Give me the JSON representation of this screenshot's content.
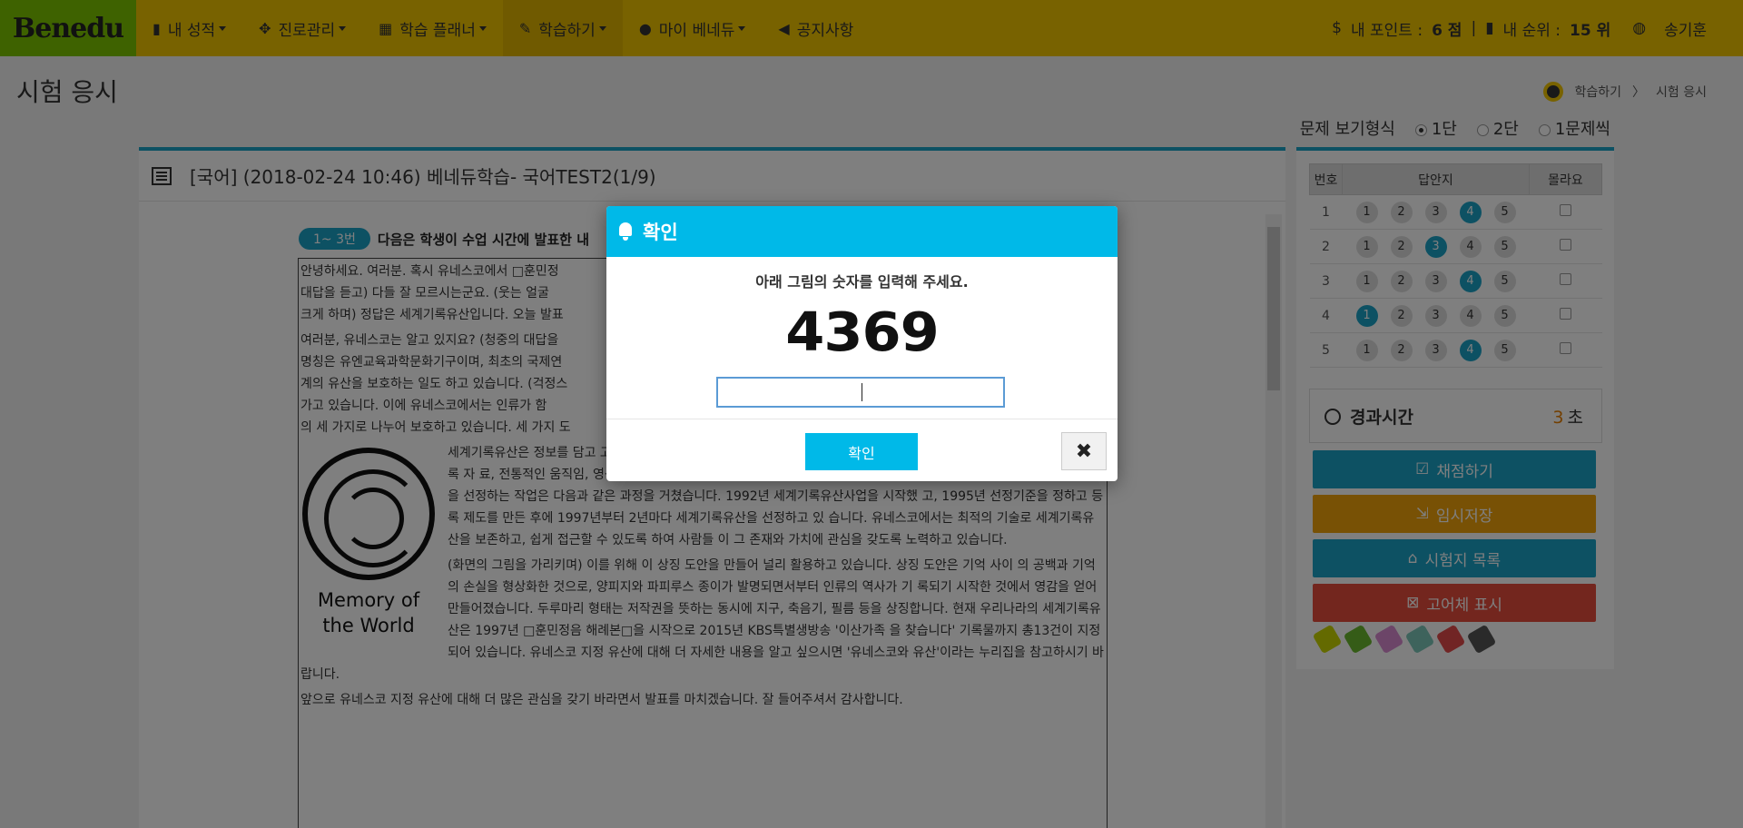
{
  "nav": {
    "logo": "Benedu",
    "items": [
      {
        "icon": "bar-chart-icon",
        "glyph": "▮",
        "label": "내 성적"
      },
      {
        "icon": "compass-icon",
        "glyph": "✥",
        "label": "진로관리"
      },
      {
        "icon": "calendar-icon",
        "glyph": "▦",
        "label": "학습 플래너"
      },
      {
        "icon": "edit-icon",
        "glyph": "✎",
        "label": "학습하기"
      },
      {
        "icon": "user-icon",
        "glyph": "●",
        "label": "마이 베네듀"
      }
    ],
    "notice": {
      "icon": "bullhorn-icon",
      "glyph": "◀",
      "label": "공지사항"
    },
    "points_label": "내 포인트 :",
    "points_value": "6 점",
    "divider": "|",
    "rank_label": "내 순위 :",
    "rank_value": "15 위",
    "user_name": "송기훈"
  },
  "page": {
    "title": "시험 응시",
    "breadcrumb": [
      "학습하기",
      "시험 응시"
    ],
    "view_type_label": "문제 보기형식",
    "view_options": [
      "1단",
      "2단",
      "1문제씩"
    ],
    "selected_view": "1단"
  },
  "exam": {
    "title": "[국어] (2018-02-24 10:46) 베네듀학습- 국어TEST2(1/9)",
    "question_range": "1~ 3번",
    "question_intro": "다음은 학생이 수업 시간에 발표한 내",
    "paragraphs": [
      "안녕하세요. 여러분. 혹시 유네스코에서 □훈민정",
      "대답을 듣고) 다들 잘 모르시는군요. (웃는 얼굴",
      "크게 하며) 정답은 세계기록유산입니다. 오늘 발표",
      "여러분, 유네스코는 알고 있지요? (청중의 대답을",
      "명칭은 유엔교육과학문화기구이며, 최초의 국제연",
      "계의 유산을 보호하는 일도 하고 있습니다. (걱정스",
      "가고 있습니다. 이에 유네스코에서는 인류가 함",
      "의 세 가지로 나누어 보호하고 있습니다. 세 가지 도"
    ],
    "logo_caption": "Memory of the World",
    "body_right": [
      "세계기록유산은 정보를 담고 ",
      "고 등에 보관된 세계적 가치가 있는 소장 문서를 가리킵니다. 이외에도 그림, 음악 등의 비(非)기록 자",
      "료, 전통적인 움직임, 영상 이미지, 정지된 이미지 등 모든 종류의 데이터가 세계기록유산에 포함됩니다.",
      "세계기록유산을 선정하는 작업은 다음과 같은 과정을 거쳤습니다. 1992년 세계기록유산사업을 시작했",
      "고, 1995년 선정기준을 정하고 등록 제도를 만든 후에 1997년부터 2년마다 세계기록유산을 선정하고 있",
      "습니다. 유네스코에서는 최적의 기술로 세계기록유산을 보존하고, 쉽게 접근할 수 있도록 하여 사람들",
      "이 그 존재와 가치에 관심을 갖도록 노력하고 있습니다.",
      "(화면의 그림을 가리키며) 이를 위해 이 상징 도안을 만들어 널리 활용하고 있습니다. 상징 도안은 기억 사이",
      "의 공백과 기억의 손실을 형상화한 것으로, 양피지와 파피루스 종이가 발명되면서부터 인류의 역사가 기",
      "록되기 시작한 것에서 영감을 얻어 만들어졌습니다. 두루마리 형태는 저작권을 뜻하는 동시에 지구, 축음기,",
      "필름 등을 상징합니다. 현재 우리나라의 세계기록유산은 1997년 □훈민정음 해례본□을 시작으로 2015년 KBS특별생방송 '이산가족",
      "을 찾습니다' 기록물까지 총13건이 지정되어 있습니다. 유네스코 지정 유산에 대해 더 자세한 내용을 알고 싶으시면 '유네스코와",
      "유산'이라는 누리집을 참고하시기 바랍니다."
    ],
    "closing": "앞으로 유네스코 지정 유산에 대해 더 많은 관심을 갖기 바라면서 발표를 마치겠습니다. 잘 들어주셔서 감사합니다."
  },
  "answers": {
    "headers": [
      "번호",
      "답안지",
      "몰라요"
    ],
    "rows": [
      {
        "num": "1",
        "options": [
          "1",
          "2",
          "3",
          "4",
          "5"
        ],
        "selected": "4"
      },
      {
        "num": "2",
        "options": [
          "1",
          "2",
          "3",
          "4",
          "5"
        ],
        "selected": "3"
      },
      {
        "num": "3",
        "options": [
          "1",
          "2",
          "3",
          "4",
          "5"
        ],
        "selected": "4"
      },
      {
        "num": "4",
        "options": [
          "1",
          "2",
          "3",
          "4",
          "5"
        ],
        "selected": "1"
      },
      {
        "num": "5",
        "options": [
          "1",
          "2",
          "3",
          "4",
          "5"
        ],
        "selected": "4"
      }
    ]
  },
  "timer": {
    "label": "경과시간",
    "value": "3",
    "unit": "초"
  },
  "actions": {
    "grade": "채점하기",
    "save": "임시저장",
    "list": "시험지 목록",
    "show_hard": "고어체 표시"
  },
  "tool_colors": [
    "#c8d400",
    "#6ab82e",
    "#d98bd0",
    "#7cc7b8",
    "#e24a4a",
    "#555555"
  ],
  "modal": {
    "title": "확인",
    "prompt": "아래 그림의 숫자를 입력해 주세요.",
    "captcha": "4369",
    "input_value": "",
    "confirm_label": "확인",
    "close_glyph": "✖"
  },
  "colors": {
    "brand_yellow": "#f1c400",
    "accent_teal": "#1aa2c7",
    "modal_blue": "#00b9e8"
  }
}
